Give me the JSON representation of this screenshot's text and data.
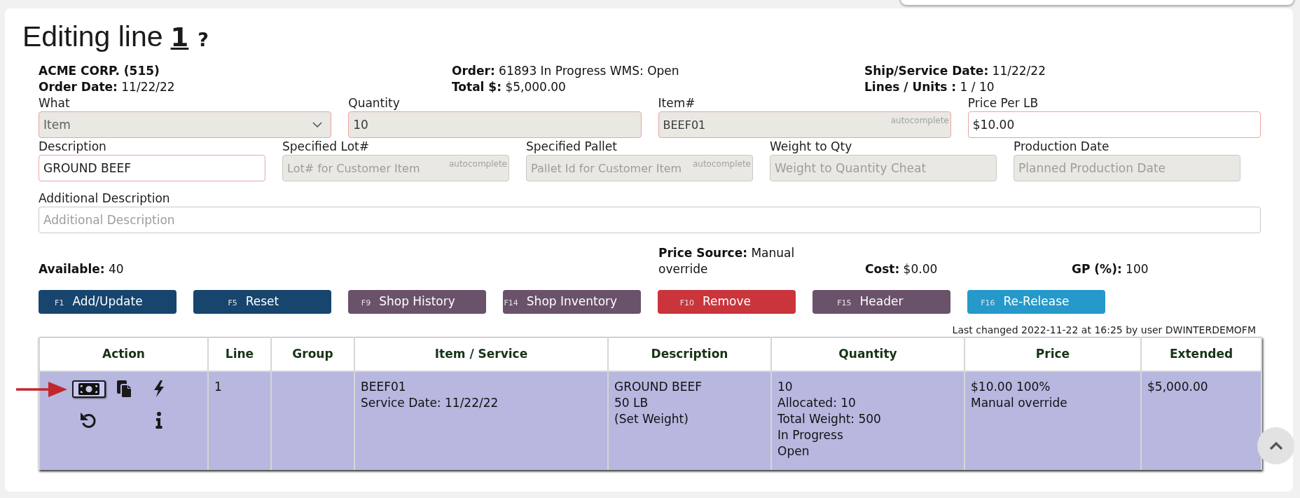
{
  "title": {
    "text": "Editing line",
    "line": "1",
    "help": "?"
  },
  "summary": {
    "customer": "ACME CORP. (515)",
    "columns": [
      [
        "**Order Date:** 11/22/22"
      ],
      [
        "**Order:** 61893 In Progress WMS: Open",
        "**Total $:** $5,000.00"
      ],
      [
        "**Ship/Service Date:** 11/22/22",
        "**Lines / Units :** 1 / 10"
      ]
    ]
  },
  "form_rows": [
    [
      {
        "label": "What",
        "kind": "select",
        "value": "Item",
        "disabled": true,
        "required": true
      },
      {
        "label": "Quantity",
        "kind": "text",
        "value": "10",
        "disabled": true,
        "required": true
      },
      {
        "label": "Item#",
        "kind": "text",
        "value": "BEEF01",
        "hint": "autocomplete",
        "disabled": true,
        "required": true
      },
      {
        "label": "Price Per LB",
        "kind": "text",
        "value": "$10.00",
        "disabled": false,
        "required": true
      }
    ],
    [
      {
        "label": "Description",
        "kind": "text",
        "value": "GROUND BEEF",
        "disabled": false,
        "required": true
      },
      {
        "label": "Specified Lot#",
        "kind": "text",
        "placeholder": "Lot# for Customer Item",
        "hint": "autocomplete",
        "disabled": true,
        "required": false
      },
      {
        "label": "Specified Pallet",
        "kind": "text",
        "placeholder": "Pallet Id for Customer Item",
        "hint": "autocomplete",
        "disabled": true,
        "required": false
      },
      {
        "label": "Weight to Qty",
        "kind": "text",
        "placeholder": "Weight to Quantity Cheat",
        "disabled": true,
        "required": false
      },
      {
        "label": "Production Date",
        "kind": "text",
        "placeholder": "Planned Production Date",
        "disabled": true,
        "required": false
      }
    ],
    [
      {
        "label": "Additional Description",
        "kind": "text",
        "placeholder": "Additional Description",
        "disabled": false,
        "required": false
      }
    ]
  ],
  "totals": [
    "**Available:** 40",
    "**Price Source:** Manual override",
    "**Cost:** $0.00",
    "**GP (%):** 100"
  ],
  "buttons": [
    {
      "key": "F1",
      "label": "Add/Update",
      "color": "#17456e"
    },
    {
      "key": "F5",
      "label": "Reset",
      "color": "#17456e"
    },
    {
      "key": "F9",
      "label": "Shop History",
      "color": "#6a526b"
    },
    {
      "key": "F14",
      "label": "Shop Inventory",
      "color": "#6a526b"
    },
    {
      "key": "F10",
      "label": "Remove",
      "color": "#c9353b"
    },
    {
      "key": "F15",
      "label": "Header",
      "color": "#6a526b"
    },
    {
      "key": "F16",
      "label": "Re-Release",
      "color": "#2599c9"
    }
  ],
  "last_changed": "Last changed 2022-11-22 at 16:25 by user DWINTERDEMOFM",
  "table": {
    "columns": [
      "Action",
      "Line",
      "Group",
      "Item / Service",
      "Description",
      "Quantity",
      "Price",
      "Extended"
    ],
    "rows": [
      {
        "selected": true,
        "actions": [
          [
            {
              "kind": "banknote",
              "selected": true
            },
            {
              "kind": "copy",
              "selected": false
            },
            {
              "kind": "bolt",
              "selected": false
            }
          ],
          [
            {
              "kind": "undo",
              "selected": false
            },
            {
              "kind": "info",
              "selected": false
            }
          ]
        ],
        "cells": [
          "",
          "1",
          "",
          "BEEF01\nService Date: 11/22/22",
          "GROUND BEEF\n50 LB\n(Set Weight)",
          "10\nAllocated: 10\nTotal Weight: 500\nIn Progress\nOpen",
          "$10.00 100%\nManual override",
          "$5,000.00"
        ]
      }
    ]
  }
}
